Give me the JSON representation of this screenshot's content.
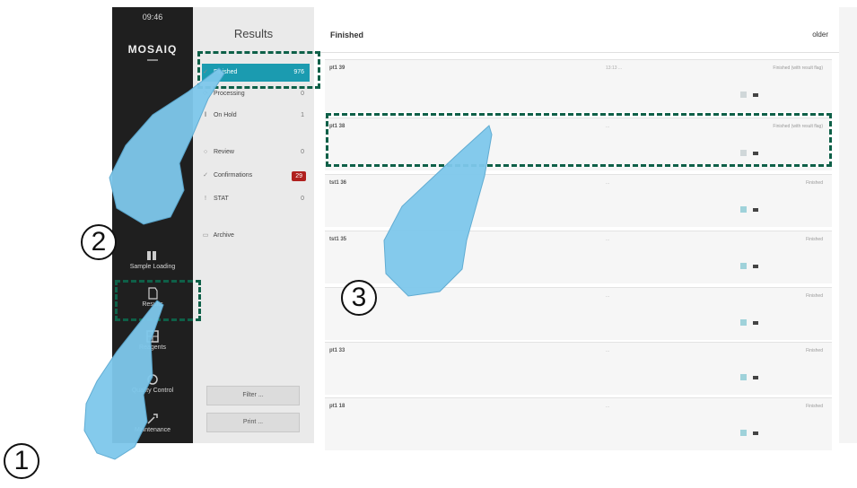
{
  "sidebar": {
    "time": "09:46",
    "logo": "MOSAIQ",
    "items": [
      {
        "label": "Sample Loading",
        "icon": "sample-loading-icon"
      },
      {
        "label": "Results",
        "icon": "results-icon"
      },
      {
        "label": "Reagents",
        "icon": "reagents-icon"
      },
      {
        "label": "Quality Control",
        "icon": "quality-control-icon"
      },
      {
        "label": "Maintenance",
        "icon": "maintenance-icon"
      }
    ]
  },
  "results": {
    "title": "Results",
    "items": [
      {
        "label": "Finished",
        "count": "976",
        "active": true
      },
      {
        "label": "Processing",
        "count": "0"
      },
      {
        "label": "On Hold",
        "count": "1"
      },
      {
        "label": "Review",
        "count": "0"
      },
      {
        "label": "Confirmations",
        "count": "29",
        "badge": true
      },
      {
        "label": "STAT",
        "count": "0"
      },
      {
        "label": "Archive",
        "count": ""
      }
    ],
    "filter_label": "Filter ...",
    "print_label": "Print ..."
  },
  "main": {
    "title": "Finished",
    "older_label": "older",
    "rows": [
      {
        "id": "pt1 39",
        "date": "13:13 ...",
        "status": "Finished (with result flag)"
      },
      {
        "id": "pt1 38",
        "date": "...",
        "status": "Finished (with result flag)"
      },
      {
        "id": "tst1 36",
        "date": "...",
        "status": "Finished"
      },
      {
        "id": "tst1 35",
        "date": "...",
        "status": "Finished"
      },
      {
        "id": "",
        "date": "...",
        "status": "Finished"
      },
      {
        "id": "pt1 33",
        "date": "...",
        "status": "Finished"
      },
      {
        "id": "pt1 18",
        "date": "...",
        "status": "Finished"
      }
    ]
  },
  "steps": [
    "1",
    "2",
    "3"
  ],
  "colors": {
    "accent": "#1b9bb0",
    "highlight_dash": "#0e6048",
    "glove": "#7ec8ec",
    "badge": "#b0201e"
  }
}
